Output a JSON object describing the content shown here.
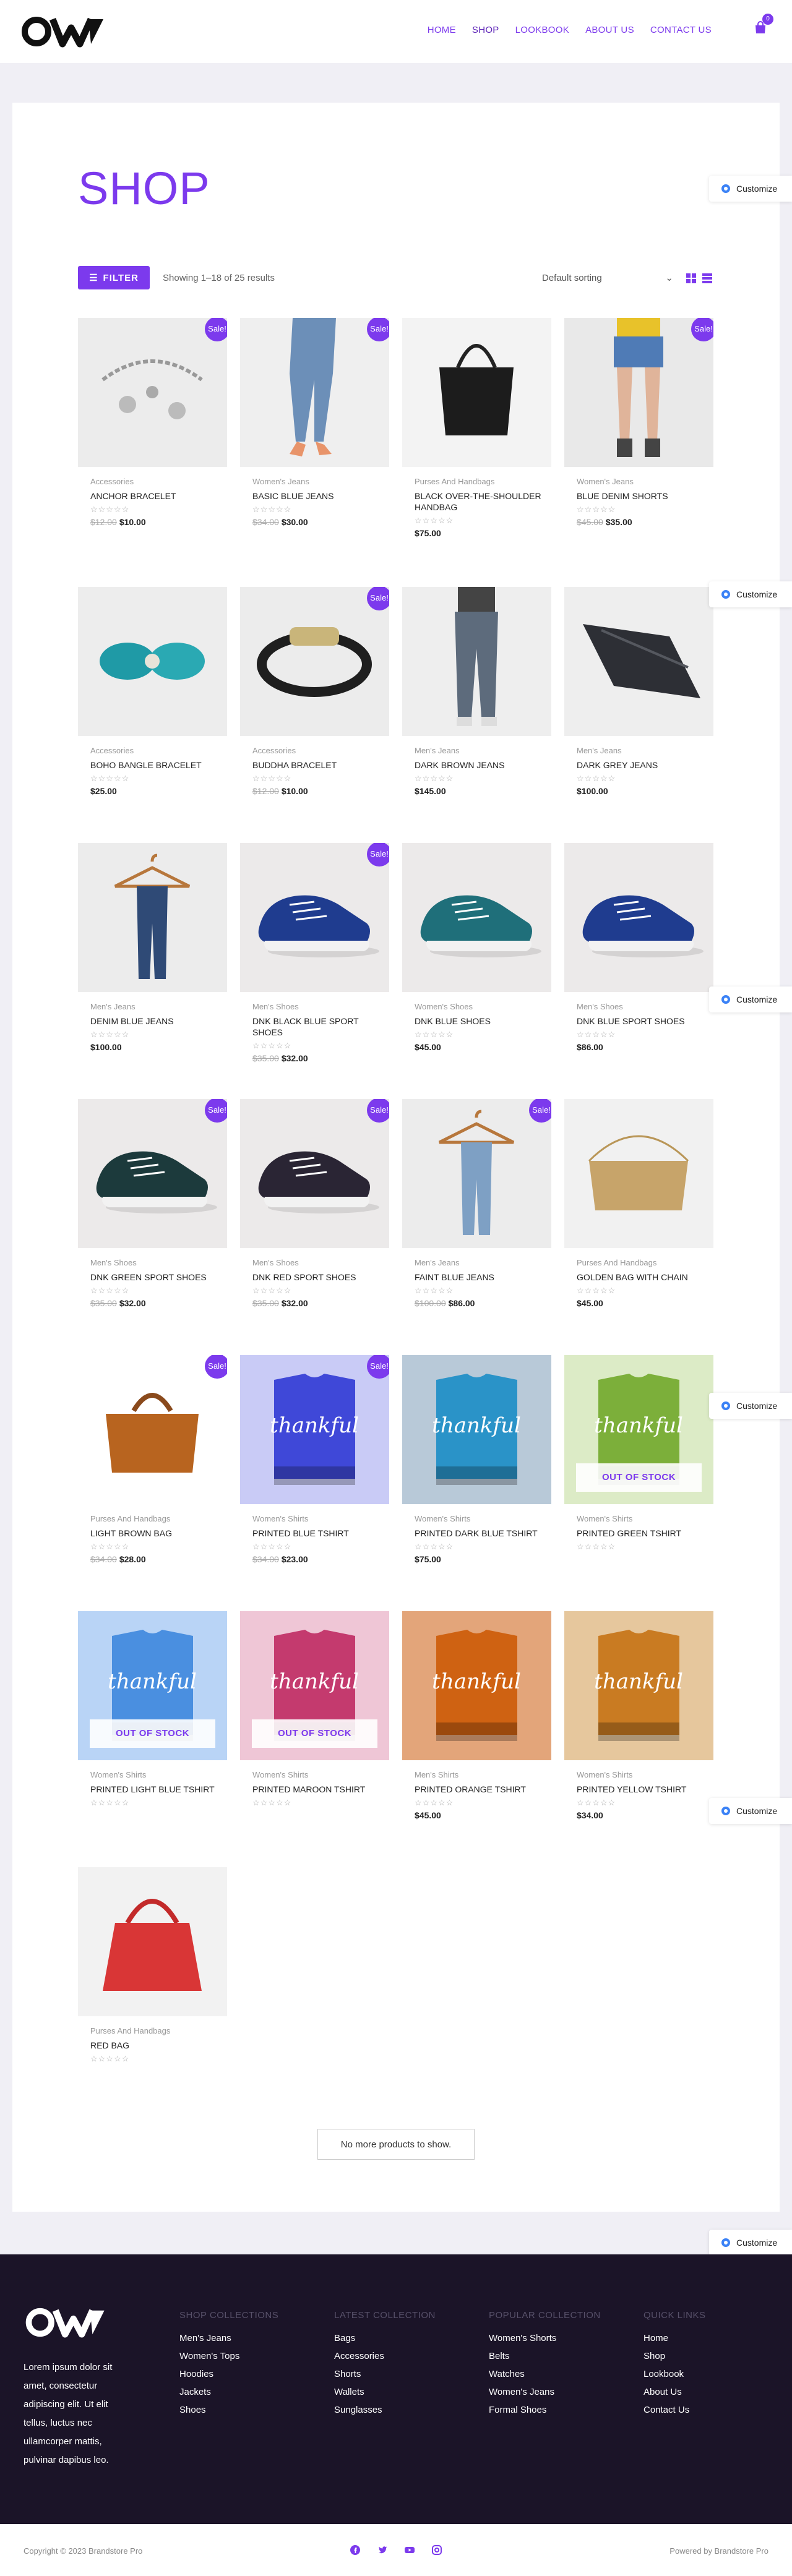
{
  "header": {
    "nav": [
      {
        "label": "HOME"
      },
      {
        "label": "SHOP"
      },
      {
        "label": "LOOKBOOK"
      },
      {
        "label": "ABOUT US"
      },
      {
        "label": "CONTACT US"
      }
    ],
    "cart_count": "0",
    "accent": "#7c3aed"
  },
  "shop": {
    "title": "SHOP",
    "filter_label": "FILTER",
    "result_count": "Showing 1–18 of 25 results",
    "sorting": "Default sorting",
    "no_more": "No more products to show."
  },
  "customize_label": "Customize",
  "products": [
    {
      "category": "Accessories",
      "name": "ANCHOR BRACELET",
      "old_price": "$12.00",
      "price": "$10.00",
      "sale": "Sale!",
      "image": "bracelet-silver"
    },
    {
      "category": "Women's Jeans",
      "name": "BASIC BLUE JEANS",
      "old_price": "$34.00",
      "price": "$30.00",
      "sale": "Sale!",
      "image": "jeans-legs"
    },
    {
      "category": "Purses And Handbags",
      "name": "BLACK OVER-THE-SHOULDER HANDBAG",
      "old_price": "",
      "price": "$75.00",
      "sale": "",
      "image": "black-handbag"
    },
    {
      "category": "Women's Jeans",
      "name": "BLUE DENIM SHORTS",
      "old_price": "$45.00",
      "price": "$35.00",
      "sale": "Sale!",
      "image": "denim-shorts"
    },
    {
      "category": "Accessories",
      "name": "BOHO BANGLE BRACELET",
      "old_price": "",
      "price": "$25.00",
      "sale": "",
      "image": "turquoise-bracelet"
    },
    {
      "category": "Accessories",
      "name": "BUDDHA BRACELET",
      "old_price": "$12.00",
      "price": "$10.00",
      "sale": "Sale!",
      "image": "leather-bracelet"
    },
    {
      "category": "Men's Jeans",
      "name": "DARK BROWN JEANS",
      "old_price": "",
      "price": "$145.00",
      "sale": "",
      "image": "mens-jeans-legs"
    },
    {
      "category": "Men's Jeans",
      "name": "DARK GREY JEANS",
      "old_price": "",
      "price": "$100.00",
      "sale": "",
      "image": "folded-jeans"
    },
    {
      "category": "Men's Jeans",
      "name": "DENIM BLUE JEANS",
      "old_price": "",
      "price": "$100.00",
      "sale": "",
      "image": "jeans-hanger"
    },
    {
      "category": "Men's Shoes",
      "name": "DNK BLACK BLUE SPORT SHOES",
      "old_price": "$35.00",
      "price": "$32.00",
      "sale": "Sale!",
      "image": "shoes-blue"
    },
    {
      "category": "Women's Shoes",
      "name": "DNK BLUE SHOES",
      "old_price": "",
      "price": "$45.00",
      "sale": "",
      "image": "shoes-teal"
    },
    {
      "category": "Men's Shoes",
      "name": "DNK BLUE SPORT SHOES",
      "old_price": "",
      "price": "$86.00",
      "sale": "",
      "image": "shoes-blue"
    },
    {
      "category": "Men's Shoes",
      "name": "DNK GREEN SPORT SHOES",
      "old_price": "$35.00",
      "price": "$32.00",
      "sale": "Sale!",
      "image": "shoes-green"
    },
    {
      "category": "Men's Shoes",
      "name": "DNK RED SPORT SHOES",
      "old_price": "$35.00",
      "price": "$32.00",
      "sale": "Sale!",
      "image": "shoes-red"
    },
    {
      "category": "Men's Jeans",
      "name": "FAINT BLUE JEANS",
      "old_price": "$100.00",
      "price": "$86.00",
      "sale": "Sale!",
      "image": "jeans-hanger-light"
    },
    {
      "category": "Purses And Handbags",
      "name": "GOLDEN BAG WITH CHAIN",
      "old_price": "",
      "price": "$45.00",
      "sale": "",
      "image": "gold-bag"
    },
    {
      "category": "Purses And Handbags",
      "name": "LIGHT BROWN BAG",
      "old_price": "$34.00",
      "price": "$28.00",
      "sale": "Sale!",
      "image": "brown-bag"
    },
    {
      "category": "Women's Shirts",
      "name": "PRINTED BLUE TSHIRT",
      "old_price": "$34.00",
      "price": "$23.00",
      "sale": "Sale!",
      "image": "tshirt",
      "shirt_color": "#3f48d8",
      "bg_color": "#c9cbf6"
    },
    {
      "category": "Women's Shirts",
      "name": "PRINTED DARK BLUE TSHIRT",
      "old_price": "",
      "price": "$75.00",
      "sale": "",
      "image": "tshirt",
      "shirt_color": "#2a93c8",
      "bg_color": "#b8c9d8"
    },
    {
      "category": "Women's Shirts",
      "name": "PRINTED GREEN TSHIRT",
      "old_price": "",
      "price": "",
      "sale": "",
      "out_of_stock": "OUT OF STOCK",
      "image": "tshirt",
      "shirt_color": "#7caf3a",
      "bg_color": "#dcebc6"
    },
    {
      "category": "Women's Shirts",
      "name": "PRINTED LIGHT BLUE TSHIRT",
      "old_price": "",
      "price": "",
      "sale": "",
      "out_of_stock": "OUT OF STOCK",
      "image": "tshirt",
      "shirt_color": "#4a8fe0",
      "bg_color": "#b9d4f6"
    },
    {
      "category": "Women's Shirts",
      "name": "PRINTED MAROON TSHIRT",
      "old_price": "",
      "price": "",
      "sale": "",
      "out_of_stock": "OUT OF STOCK",
      "image": "tshirt",
      "shirt_color": "#c43a6e",
      "bg_color": "#efc6d6"
    },
    {
      "category": "Men's Shirts",
      "name": "PRINTED ORANGE TSHIRT",
      "old_price": "",
      "price": "$45.00",
      "sale": "",
      "image": "tshirt",
      "shirt_color": "#cf6212",
      "bg_color": "#e3a57a"
    },
    {
      "category": "Women's Shirts",
      "name": "PRINTED YELLOW TSHIRT",
      "old_price": "",
      "price": "$34.00",
      "sale": "",
      "image": "tshirt",
      "shirt_color": "#c97b22",
      "bg_color": "#e6c79d"
    },
    {
      "category": "Purses And Handbags",
      "name": "RED BAG",
      "old_price": "",
      "price": "",
      "sale": "",
      "image": "red-bag"
    }
  ],
  "tshirt_text": "thankful",
  "footer": {
    "about": "Lorem ipsum dolor sit amet, consectetur adipiscing elit. Ut elit tellus, luctus nec ullamcorper mattis, pulvinar dapibus leo.",
    "columns": [
      {
        "title": "SHOP COLLECTIONS",
        "links": [
          "Men's Jeans",
          "Women's Tops",
          "Hoodies",
          "Jackets",
          "Shoes"
        ]
      },
      {
        "title": "LATEST COLLECTION",
        "links": [
          "Bags",
          "Accessories",
          "Shorts",
          "Wallets",
          "Sunglasses"
        ]
      },
      {
        "title": "POPULAR COLLECTION",
        "links": [
          "Women's Shorts",
          "Belts",
          "Watches",
          "Women's Jeans",
          "Formal Shoes"
        ]
      },
      {
        "title": "QUICK LINKS",
        "links": [
          "Home",
          "Shop",
          "Lookbook",
          "About Us",
          "Contact Us"
        ]
      }
    ],
    "copyright": "Copyright © 2023 Brandstore Pro",
    "powered": "Powered by Brandstore Pro",
    "socials": [
      "facebook-icon",
      "twitter-icon",
      "youtube-icon",
      "instagram-icon"
    ]
  }
}
